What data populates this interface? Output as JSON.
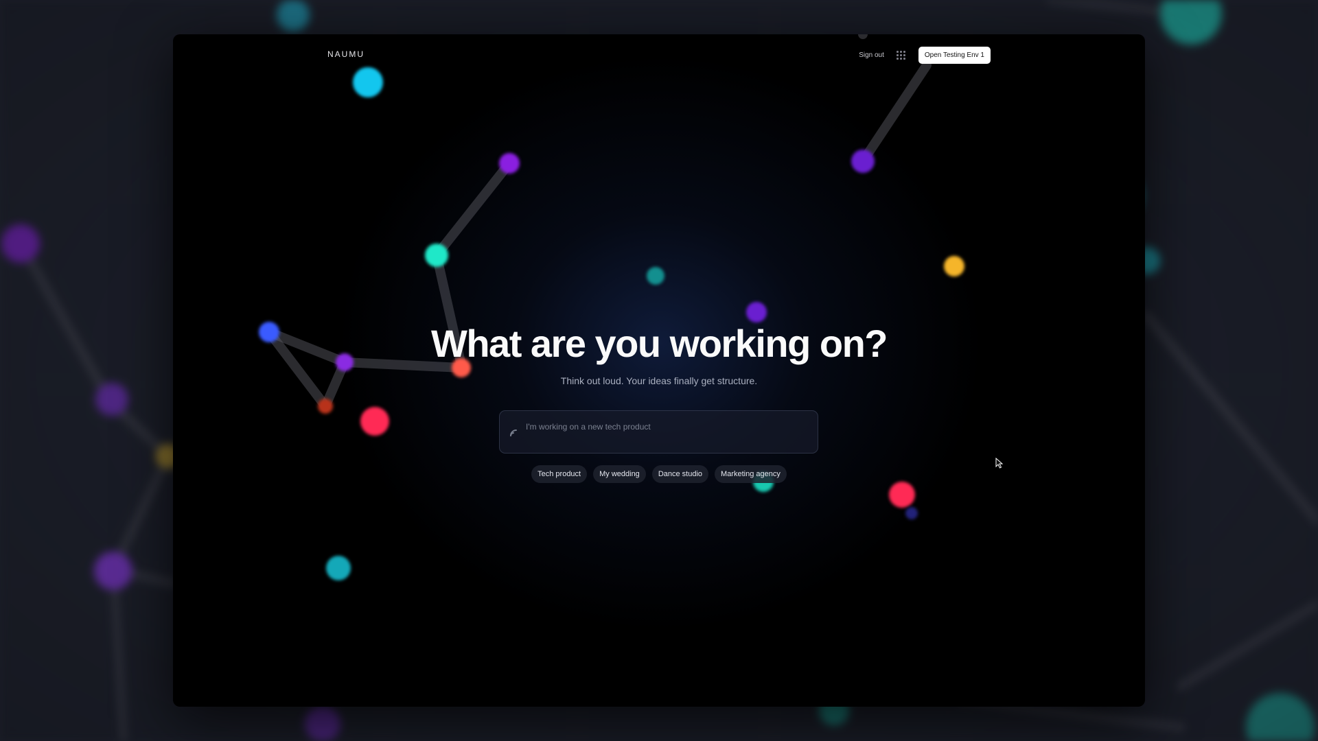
{
  "app": {
    "brand": "NAUMU"
  },
  "nav": {
    "sign_out_label": "Sign out",
    "apps_icon": "grid-icon",
    "open_env_label": "Open Testing Env 1"
  },
  "hero": {
    "title": "What are you working on?",
    "subtitle": "Think out loud. Your ideas finally get structure."
  },
  "prompt": {
    "placeholder": "I'm working on a new tech product",
    "value": "",
    "icon": "sparkle-icon"
  },
  "suggestions": [
    {
      "label": "Tech product"
    },
    {
      "label": "My wedding"
    },
    {
      "label": "Dance studio"
    },
    {
      "label": "Marketing agency"
    }
  ],
  "colors": {
    "window_bg": "#000000",
    "page_bg": "#1a1d27",
    "accent_button": "#ffffff",
    "node_cyan": "#1fe0c8",
    "node_purple": "#8a2be2",
    "node_red": "#ff2a55",
    "node_blue": "#3a5bff",
    "node_amber": "#f5b52a"
  }
}
